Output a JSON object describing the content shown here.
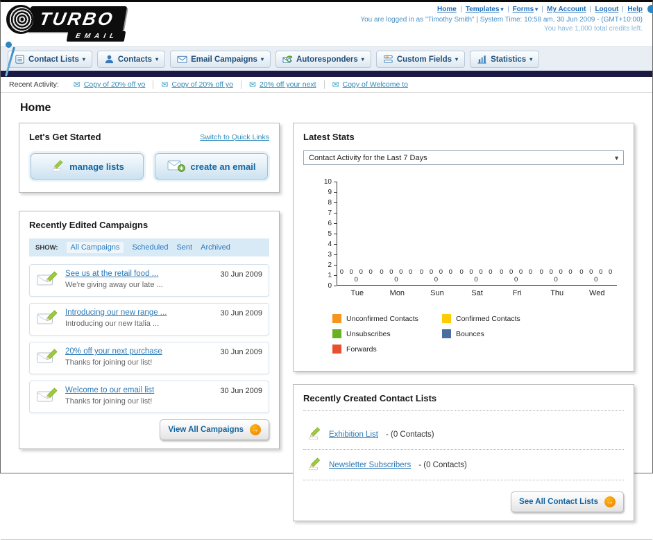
{
  "icons": {
    "dropdown_arrow": "▾",
    "select_arrow": "▼",
    "envelope": "✉",
    "arrow_right": "→"
  },
  "header": {
    "logo_main": "TURBO",
    "logo_sub": "EMAIL",
    "links": [
      {
        "label": "Home"
      },
      {
        "label": "Templates"
      },
      {
        "label": "Forms"
      },
      {
        "label": "My Account"
      },
      {
        "label": "Logout"
      },
      {
        "label": "Help"
      }
    ],
    "login_info": "You are logged in as \"Timothy Smith\" | System Time: 10:58 am, 30 Jun 2009 - (GMT+10:00)",
    "credits_info": "You have 1,000 total credits left."
  },
  "nav": {
    "tabs": [
      {
        "label": "Contact Lists"
      },
      {
        "label": "Contacts"
      },
      {
        "label": "Email Campaigns"
      },
      {
        "label": "Autoresponders"
      },
      {
        "label": "Custom Fields"
      },
      {
        "label": "Statistics"
      }
    ]
  },
  "recent_activity": {
    "label": "Recent Activity:",
    "items": [
      "Copy of 20% off yo",
      "Copy of 20% off yo",
      "20% off your next",
      "Copy of Welcome to"
    ]
  },
  "page_title": "Home",
  "get_started": {
    "title": "Let's Get Started",
    "switch_link": "Switch to Quick Links",
    "manage_lists": "manage lists",
    "create_email": "create an email"
  },
  "campaigns": {
    "title": "Recently Edited Campaigns",
    "show_label": "SHOW:",
    "filters": [
      "All Campaigns",
      "Scheduled",
      "Sent",
      "Archived"
    ],
    "items": [
      {
        "title": "See us at the retail food ...",
        "subtitle": "We're giving away our late ...",
        "date": "30 Jun 2009"
      },
      {
        "title": "Introducing our new range ...",
        "subtitle": "Introducing our new Italia ...",
        "date": "30 Jun 2009"
      },
      {
        "title": "20% off your next purchase",
        "subtitle": "Thanks for joining our list!",
        "date": "30 Jun 2009"
      },
      {
        "title": "Welcome to our email list",
        "subtitle": "Thanks for joining our list!",
        "date": "30 Jun 2009"
      }
    ],
    "view_all_label": "View All Campaigns"
  },
  "stats": {
    "title": "Latest Stats",
    "dropdown_value": "Contact Activity for the Last 7 Days",
    "legend": [
      {
        "label": "Unconfirmed Contacts",
        "color": "#f7941d"
      },
      {
        "label": "Confirmed Contacts",
        "color": "#ffcb05"
      },
      {
        "label": "Unsubscribes",
        "color": "#6ab023"
      },
      {
        "label": "Bounces",
        "color": "#4a6e9e"
      },
      {
        "label": "Forwards",
        "color": "#e8502d"
      }
    ]
  },
  "chart_data": {
    "type": "bar",
    "title": "Contact Activity for the Last 7 Days",
    "categories": [
      "Tue",
      "Mon",
      "Sun",
      "Sat",
      "Fri",
      "Thu",
      "Wed"
    ],
    "series": [
      {
        "name": "Unconfirmed Contacts",
        "values": [
          0,
          0,
          0,
          0,
          0,
          0,
          0
        ]
      },
      {
        "name": "Confirmed Contacts",
        "values": [
          0,
          0,
          0,
          0,
          0,
          0,
          0
        ]
      },
      {
        "name": "Unsubscribes",
        "values": [
          0,
          0,
          0,
          0,
          0,
          0,
          0
        ]
      },
      {
        "name": "Bounces",
        "values": [
          0,
          0,
          0,
          0,
          0,
          0,
          0
        ]
      },
      {
        "name": "Forwards",
        "values": [
          0,
          0,
          0,
          0,
          0,
          0,
          0
        ]
      }
    ],
    "ylim": [
      0,
      10
    ],
    "y_step": 1,
    "grid": false,
    "legend_position": "bottom"
  },
  "contact_lists": {
    "title": "Recently Created Contact Lists",
    "items": [
      {
        "name": "Exhibition List",
        "detail": "- (0 Contacts)"
      },
      {
        "name": "Newsletter Subscribers",
        "detail": "- (0 Contacts)"
      }
    ],
    "see_all_label": "See All Contact Lists"
  }
}
